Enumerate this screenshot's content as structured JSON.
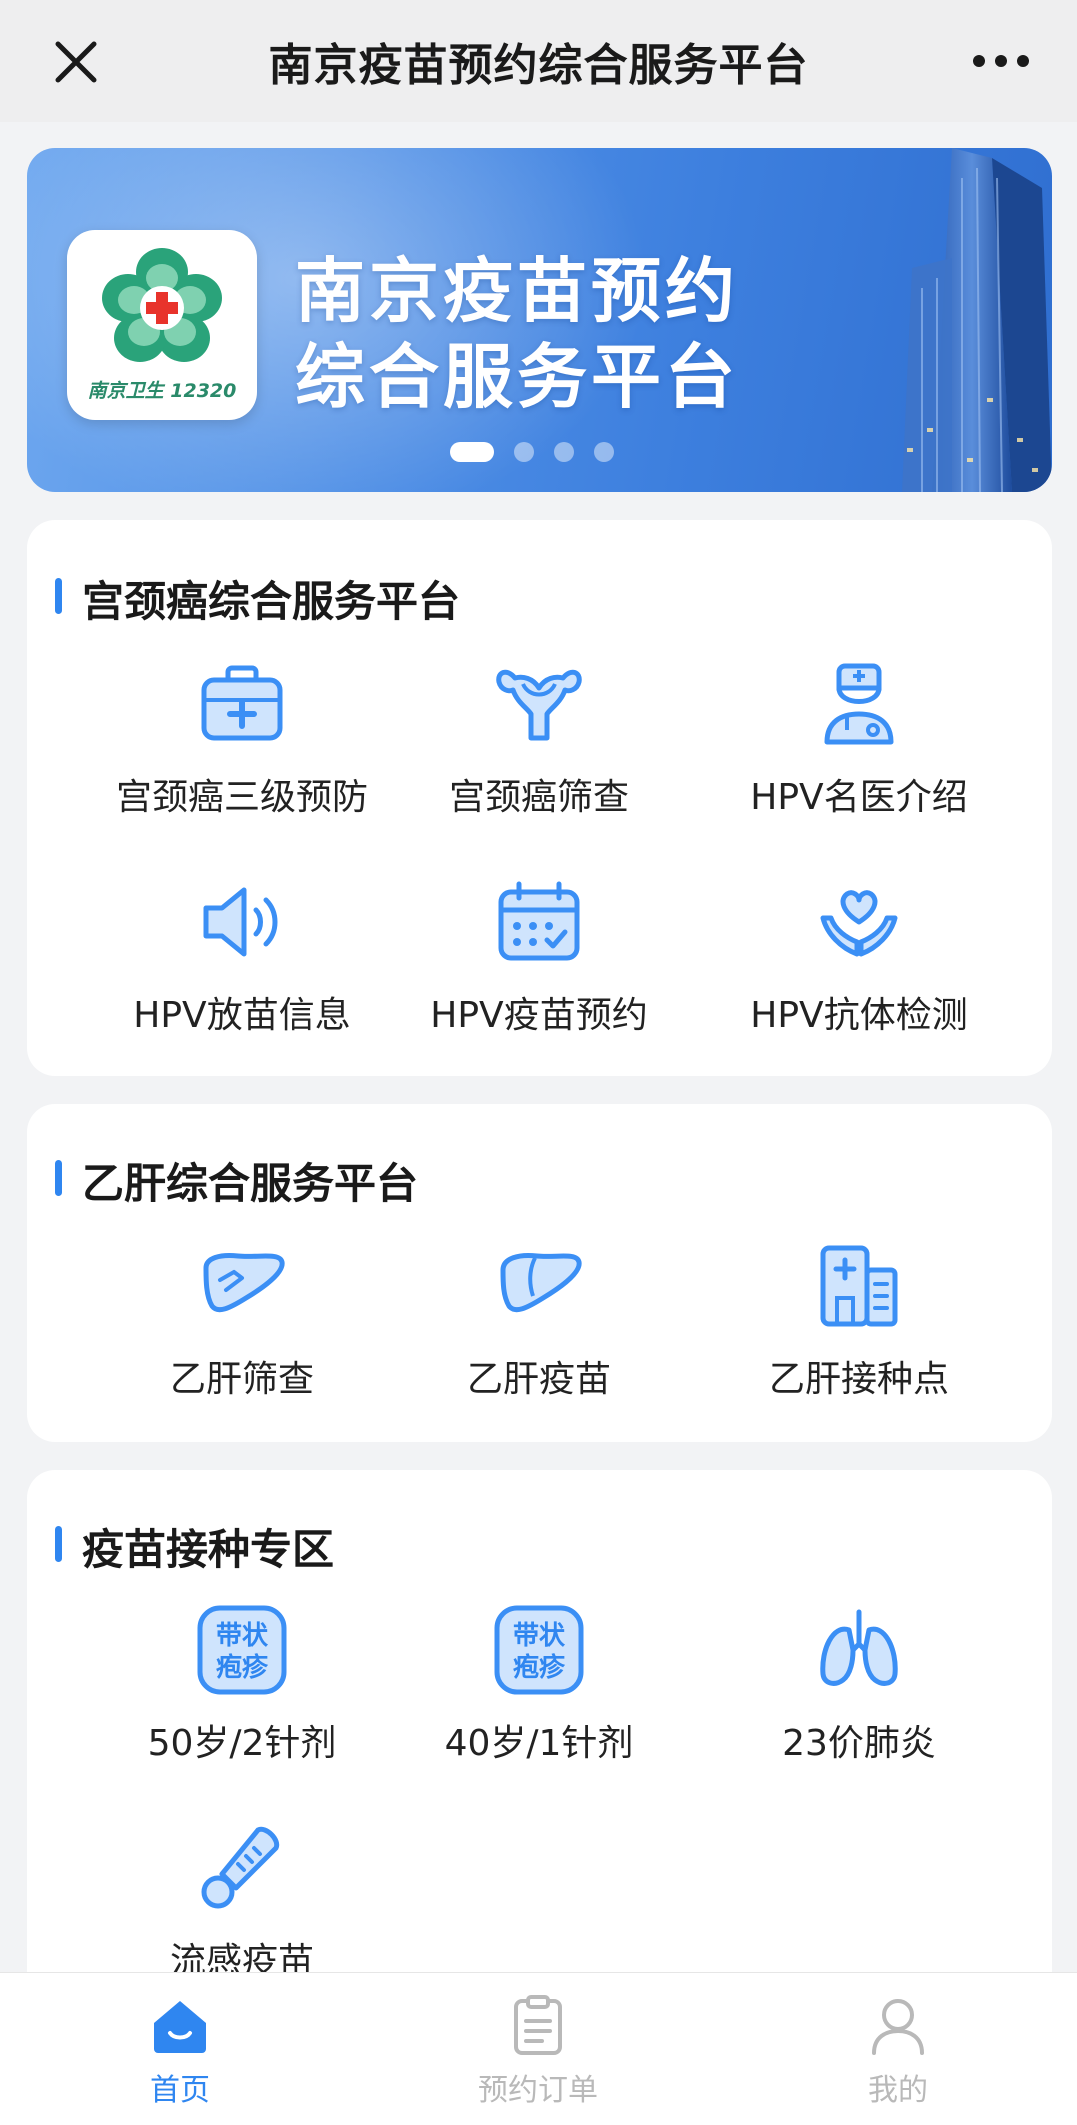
{
  "nav": {
    "title": "南京疫苗预约综合服务平台",
    "close_icon": "close-icon",
    "more_icon": "more-icon"
  },
  "banner": {
    "logo_text": "南京卫生 12320",
    "title_line1": "南京疫苗预约",
    "title_line2": "综合服务平台",
    "slides": 4,
    "active_slide": 1
  },
  "sections": {
    "cervical": {
      "title": "宫颈癌综合服务平台",
      "items": [
        {
          "label": "宫颈癌三级预防",
          "icon": "medical-kit-icon"
        },
        {
          "label": "宫颈癌筛查",
          "icon": "uterus-icon"
        },
        {
          "label": "HPV名医介绍",
          "icon": "doctor-icon"
        },
        {
          "label": "HPV放苗信息",
          "icon": "speaker-icon"
        },
        {
          "label": "HPV疫苗预约",
          "icon": "calendar-icon"
        },
        {
          "label": "HPV抗体检测",
          "icon": "heart-hands-icon"
        }
      ]
    },
    "hepatitis": {
      "title": "乙肝综合服务平台",
      "items": [
        {
          "label": "乙肝筛查",
          "icon": "liver-search-icon"
        },
        {
          "label": "乙肝疫苗",
          "icon": "liver-icon"
        },
        {
          "label": "乙肝接种点",
          "icon": "hospital-icon"
        }
      ]
    },
    "vaccine": {
      "title": "疫苗接种专区",
      "badge_text_line1": "带状",
      "badge_text_line2": "疱疹",
      "items": [
        {
          "label": "50岁/2针剂",
          "icon": "shingles-badge-icon"
        },
        {
          "label": "40岁/1针剂",
          "icon": "shingles-badge-icon"
        },
        {
          "label": "23价肺炎",
          "icon": "lungs-icon"
        },
        {
          "label": "流感疫苗",
          "icon": "thermometer-icon"
        }
      ]
    }
  },
  "tabbar": {
    "home": "首页",
    "orders": "预约订单",
    "mine": "我的",
    "active": "home"
  },
  "colors": {
    "accent": "#2f86f0",
    "icon_blue": "#3b8ff5",
    "icon_fill": "#cfe4fd",
    "inactive": "#b9b9b9"
  }
}
